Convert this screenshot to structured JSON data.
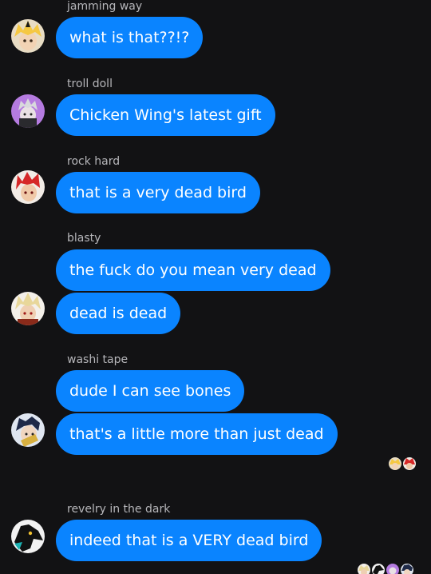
{
  "messages": [
    {
      "sender": "jamming way",
      "texts": [
        "what is that??!?"
      ]
    },
    {
      "sender": "troll doll",
      "texts": [
        "Chicken Wing's latest gift"
      ]
    },
    {
      "sender": "rock hard",
      "texts": [
        "that is a very dead bird"
      ]
    },
    {
      "sender": "blasty",
      "texts": [
        "the fuck do you mean very dead",
        "dead is dead"
      ]
    },
    {
      "sender": "washi tape",
      "texts": [
        "dude I can see bones",
        "that's a little more than just dead"
      ]
    },
    {
      "sender": "revelry in the dark",
      "texts": [
        "indeed that is a VERY dead bird"
      ]
    }
  ],
  "colors": {
    "background": "#121214",
    "bubble": "#0a84ff",
    "bubble_text": "#ffffff",
    "sender_text": "#b6b6ba"
  },
  "avatars": [
    "blond-yellow-hair-avatar",
    "grey-haired-purple-bg-avatar",
    "red-spiky-hair-avatar",
    "blond-spiky-hair-avatar",
    "dark-blue-hair-avatar",
    "black-bird-head-avatar"
  ]
}
